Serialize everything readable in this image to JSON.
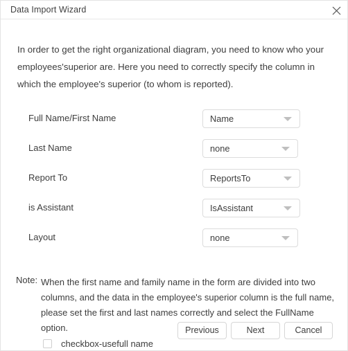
{
  "window": {
    "title": "Data Import Wizard",
    "close_icon": "close-icon"
  },
  "intro": {
    "text": "In order to get the right organizational diagram, you need to know who your employees'superior are. Here you need to correctly specify the column in which the employee's superior (to whom is reported)."
  },
  "form": {
    "rows": [
      {
        "label": "Full Name/First Name",
        "value": "Name",
        "icon": "chevron-down-icon"
      },
      {
        "label": "Last Name",
        "value": "none",
        "icon": "chevron-down-icon"
      },
      {
        "label": "Report To",
        "value": "ReportsTo",
        "icon": "chevron-down-icon"
      },
      {
        "label": "is Assistant",
        "value": "IsAssistant",
        "icon": "chevron-down-icon"
      },
      {
        "label": "Layout",
        "value": "none",
        "icon": "chevron-down-icon"
      }
    ]
  },
  "note": {
    "label": "Note:",
    "text": "When the first name and family name in the form are divided into two columns, and the data in the employee's superior column is the full name, please set the first and last names correctly and select the FullName option."
  },
  "buttons": {
    "previous": "Previous",
    "next": "Next",
    "cancel": "Cancel"
  },
  "checkbox": {
    "label": "checkbox-usefull name",
    "checked": false
  },
  "colors": {
    "background": "#ffffff",
    "text": "#3d3d3d",
    "border": "#dcdcdc",
    "arrow": "#bfbfbf"
  }
}
